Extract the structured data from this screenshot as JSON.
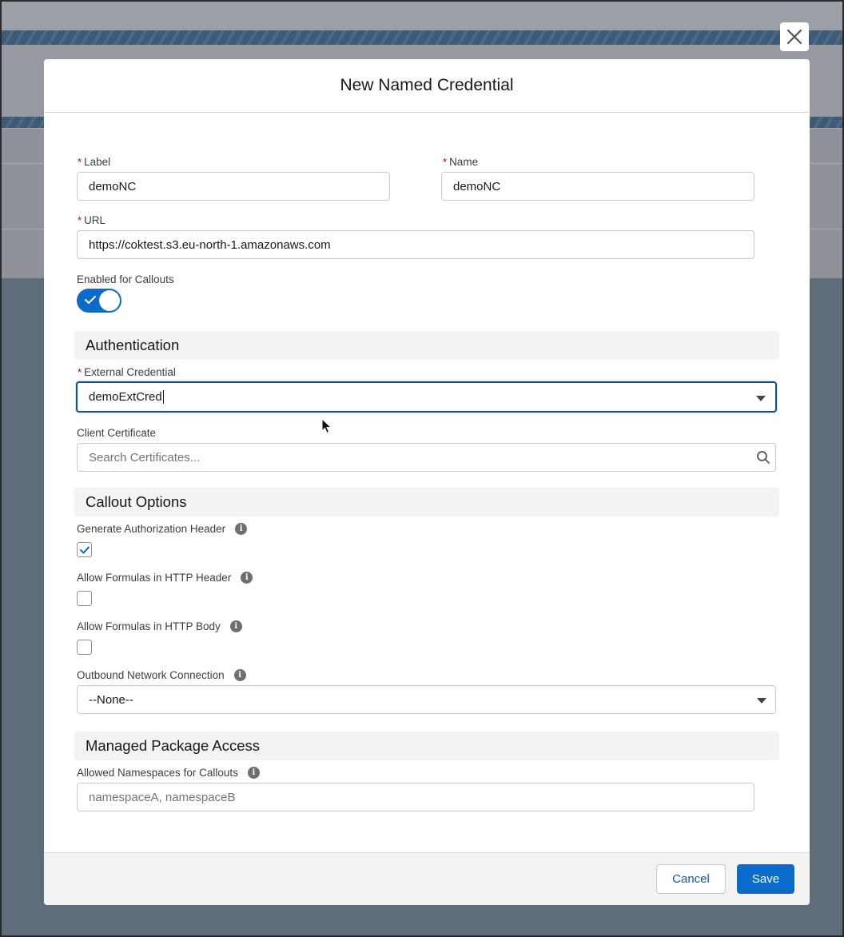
{
  "modal": {
    "title": "New Named Credential",
    "close_icon": "close-icon"
  },
  "form": {
    "label": {
      "label": "Label",
      "value": "demoNC",
      "required": true
    },
    "name": {
      "label": "Name",
      "value": "demoNC",
      "required": true
    },
    "url": {
      "label": "URL",
      "value": "https://coktest.s3.eu-north-1.amazonaws.com",
      "required": true
    },
    "enabled_for_callouts": {
      "label": "Enabled for Callouts",
      "checked": true
    }
  },
  "authentication": {
    "heading": "Authentication",
    "external_credential": {
      "label": "External Credential",
      "value": "demoExtCred",
      "required": true
    },
    "client_certificate": {
      "label": "Client Certificate",
      "placeholder": "Search Certificates..."
    }
  },
  "callout_options": {
    "heading": "Callout Options",
    "generate_auth_header": {
      "label": "Generate Authorization Header",
      "checked": true
    },
    "allow_formulas_header": {
      "label": "Allow Formulas in HTTP Header",
      "checked": false
    },
    "allow_formulas_body": {
      "label": "Allow Formulas in HTTP Body",
      "checked": false
    },
    "outbound_network": {
      "label": "Outbound Network Connection",
      "value": "--None--"
    }
  },
  "managed_package": {
    "heading": "Managed Package Access",
    "allowed_namespaces": {
      "label": "Allowed Namespaces for Callouts",
      "placeholder": "namespaceA, namespaceB"
    }
  },
  "footer": {
    "cancel_label": "Cancel",
    "save_label": "Save"
  },
  "required_marker": "*",
  "colors": {
    "brand": "#0b6bcb",
    "required": "#ba0517",
    "focus_border": "#1b4d8c",
    "backdrop": "#5f6d7b"
  }
}
